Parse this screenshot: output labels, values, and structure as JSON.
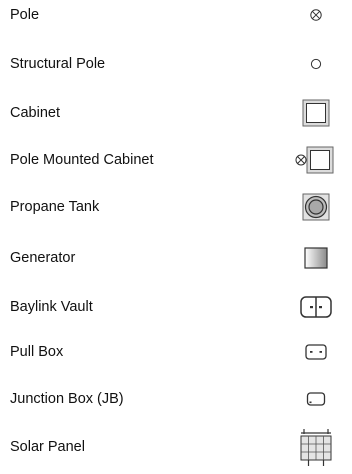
{
  "legend": {
    "items": [
      {
        "label": "Pole",
        "icon": "pole-icon"
      },
      {
        "label": "Structural Pole",
        "icon": "structural-pole-icon"
      },
      {
        "label": "Cabinet",
        "icon": "cabinet-icon"
      },
      {
        "label": "Pole Mounted Cabinet",
        "icon": "pole-mounted-cabinet-icon"
      },
      {
        "label": "Propane Tank",
        "icon": "propane-tank-icon"
      },
      {
        "label": "Generator",
        "icon": "generator-icon"
      },
      {
        "label": "Baylink Vault",
        "icon": "baylink-vault-icon"
      },
      {
        "label": "Pull Box",
        "icon": "pull-box-icon"
      },
      {
        "label": "Junction Box (JB)",
        "icon": "junction-box-icon"
      },
      {
        "label": "Solar Panel",
        "icon": "solar-panel-icon"
      }
    ]
  },
  "colors": {
    "text": "#111111",
    "stroke": "#333333",
    "cabinet_fill": "#dcdcdc",
    "propane_fill": "#a9a9a9",
    "generator_gradient_start": "#ffffff",
    "generator_gradient_end": "#8a8a8a",
    "solar_fill": "#e4e4e4"
  }
}
